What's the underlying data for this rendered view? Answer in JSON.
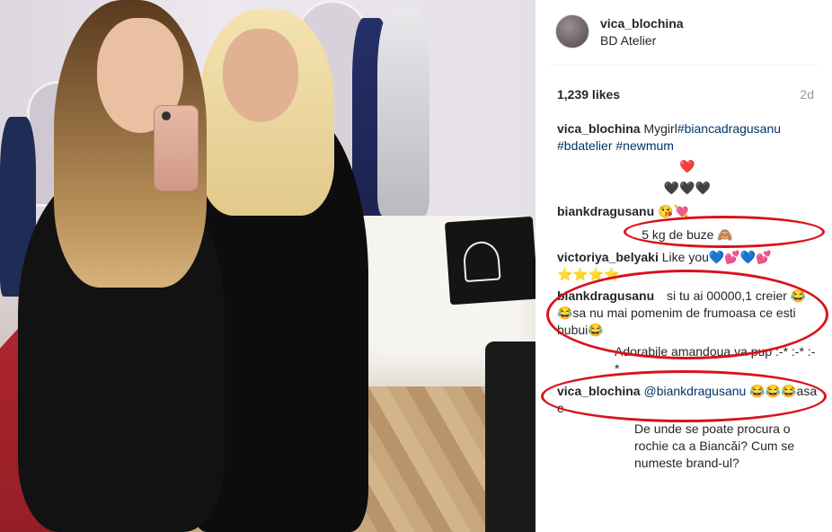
{
  "post": {
    "username": "vica_blochina",
    "location": "BD Atelier",
    "likes": "1,239 likes",
    "time_ago": "2d"
  },
  "comments": [
    {
      "user": "vica_blochina",
      "text": "Mygirl",
      "tags": [
        "#biancadragusanu",
        "#bdatelier",
        "#newmum"
      ]
    },
    {
      "line": "❤️"
    },
    {
      "line": "🖤🖤🖤"
    },
    {
      "user": "biankdragusanu",
      "text": "😘💘"
    },
    {
      "line": "5 kg de buze 🙈"
    },
    {
      "user": "victoriya_belyaki",
      "text": "Like you💙💕💙💕⭐⭐⭐⭐"
    },
    {
      "user": "biankdragusanu",
      "text": "si tu ai 00000,1 creier 😂😂sa nu mai pomenim de frumoasa ce esti bubui😂"
    },
    {
      "line": "Adorabile amandoua va pup :-* :-* :-*"
    },
    {
      "user": "vica_blochina",
      "mention": "@biankdragusanu",
      "text": "😂😂😂asa e"
    },
    {
      "line": "De unde se poate procura o rochie ca a Biancăi? Cum se numeste brand-ul?"
    }
  ],
  "colors": {
    "annotation_ring": "#d8121c",
    "hashtag": "#003569",
    "meta_gray": "#999999"
  }
}
